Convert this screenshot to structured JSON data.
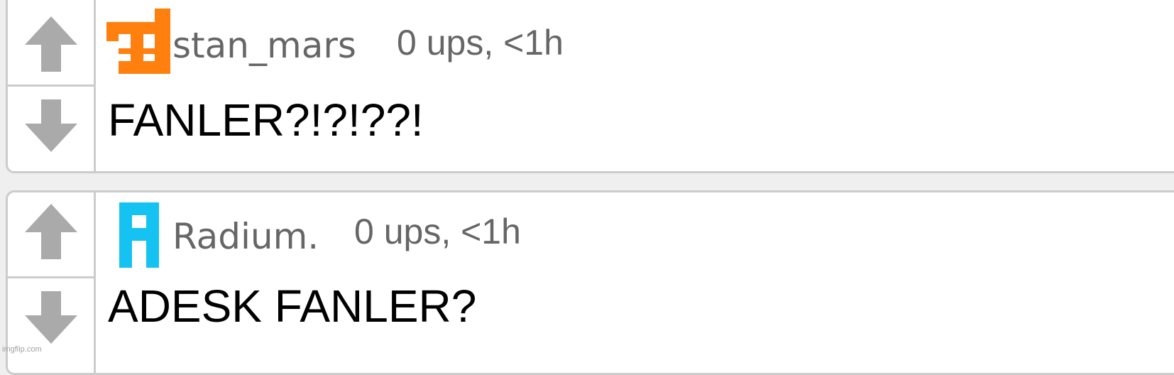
{
  "comments": [
    {
      "username": "stan_mars",
      "meta": "0 ups, <1h",
      "text": "FANLER?!?!??!",
      "avatar_color": "#ff7f0f",
      "avatar_icon": "pixel-identicon"
    },
    {
      "username": "Radium.",
      "meta": "0 ups, <1h",
      "text": "ADESK FANLER?",
      "avatar_color": "#15c3f2",
      "avatar_icon": "pixel-identicon"
    }
  ],
  "icons": {
    "upvote": "arrow-up-icon",
    "downvote": "arrow-down-icon"
  },
  "colors": {
    "page_background": "#efefef",
    "card_background": "#ffffff",
    "border": "#cccccc",
    "vote_arrow": "#aaaaaa",
    "meta_text": "#666666",
    "comment_text": "#000000"
  },
  "watermark": "imgflip.com"
}
